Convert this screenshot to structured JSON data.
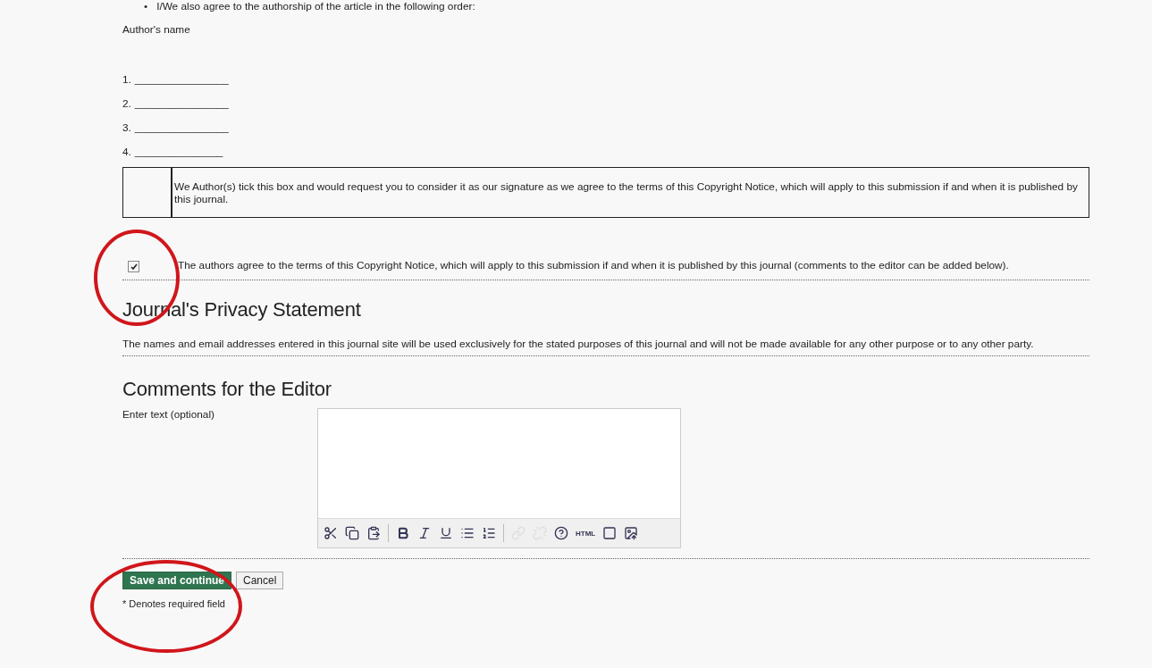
{
  "agreement_bullets": [
    {
      "marker": "•",
      "text": "I/We also agree to the authorship of the article in the following order:"
    }
  ],
  "authors_label": "Author's name",
  "author_lines": [
    {
      "number": "1.",
      "line": "________________"
    },
    {
      "number": "2.",
      "line": "________________"
    },
    {
      "number": "3.",
      "line": "________________"
    },
    {
      "number": "4.",
      "line": "_______________"
    }
  ],
  "signature_box": {
    "text": "We  Author(s) tick this box and would request you to consider it as our signature as we agree to the terms of this Copyright Notice, which will apply to this submission if and when it is published by this journal."
  },
  "copyright_agreement": {
    "checked": true,
    "text": "The authors agree to the terms of this Copyright Notice, which will apply to this submission if and when it is published by this journal (comments to the editor can be added below)."
  },
  "privacy": {
    "heading": "Journal's Privacy Statement",
    "text": "The names and email addresses entered in this journal site will be used exclusively for the stated purposes of this journal and will not be made available for any other purpose or to any other party."
  },
  "comments": {
    "heading": "Comments for the Editor",
    "label": "Enter text (optional)",
    "toolbar": [
      {
        "kind": "cut",
        "disabled": false
      },
      {
        "kind": "copy",
        "disabled": false
      },
      {
        "kind": "paste",
        "disabled": false
      },
      {
        "kind": "separator"
      },
      {
        "kind": "bold",
        "disabled": false
      },
      {
        "kind": "italic",
        "disabled": false
      },
      {
        "kind": "underline",
        "disabled": false
      },
      {
        "kind": "bullets",
        "disabled": false
      },
      {
        "kind": "numbers",
        "disabled": false
      },
      {
        "kind": "separator"
      },
      {
        "kind": "link",
        "disabled": true
      },
      {
        "kind": "unlink",
        "disabled": true
      },
      {
        "kind": "help",
        "disabled": false
      },
      {
        "kind": "html",
        "label": "HTML",
        "disabled": false
      },
      {
        "kind": "fullscreen",
        "disabled": false
      },
      {
        "kind": "image",
        "disabled": false
      }
    ]
  },
  "buttons": [
    {
      "label": "Save and continue",
      "kind": "primary"
    },
    {
      "label": "Cancel",
      "kind": "secondary"
    }
  ],
  "required_note": "* Denotes required field"
}
